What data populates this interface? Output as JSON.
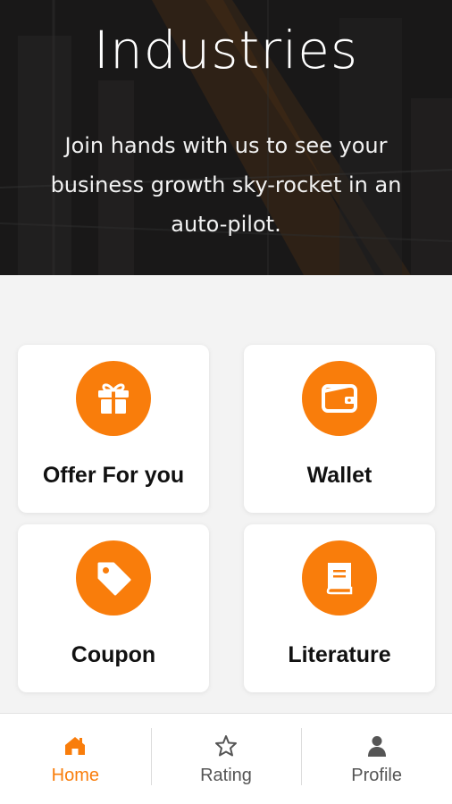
{
  "hero": {
    "title": "Industries",
    "subtitle": "Join hands with us to see your business growth sky-rocket in an auto-pilot."
  },
  "cards": [
    {
      "label": "Offer For you",
      "icon": "gift-icon"
    },
    {
      "label": "Wallet",
      "icon": "wallet-icon"
    },
    {
      "label": "Coupon",
      "icon": "tag-icon"
    },
    {
      "label": "Literature",
      "icon": "book-icon"
    }
  ],
  "nav": [
    {
      "label": "Home",
      "icon": "home-icon",
      "active": true
    },
    {
      "label": "Rating",
      "icon": "star-icon",
      "active": false
    },
    {
      "label": "Profile",
      "icon": "person-icon",
      "active": false
    }
  ],
  "colors": {
    "accent": "#f97d0b",
    "nav_inactive": "#555555",
    "card_bg": "#ffffff",
    "page_bg": "#f3f3f3"
  }
}
